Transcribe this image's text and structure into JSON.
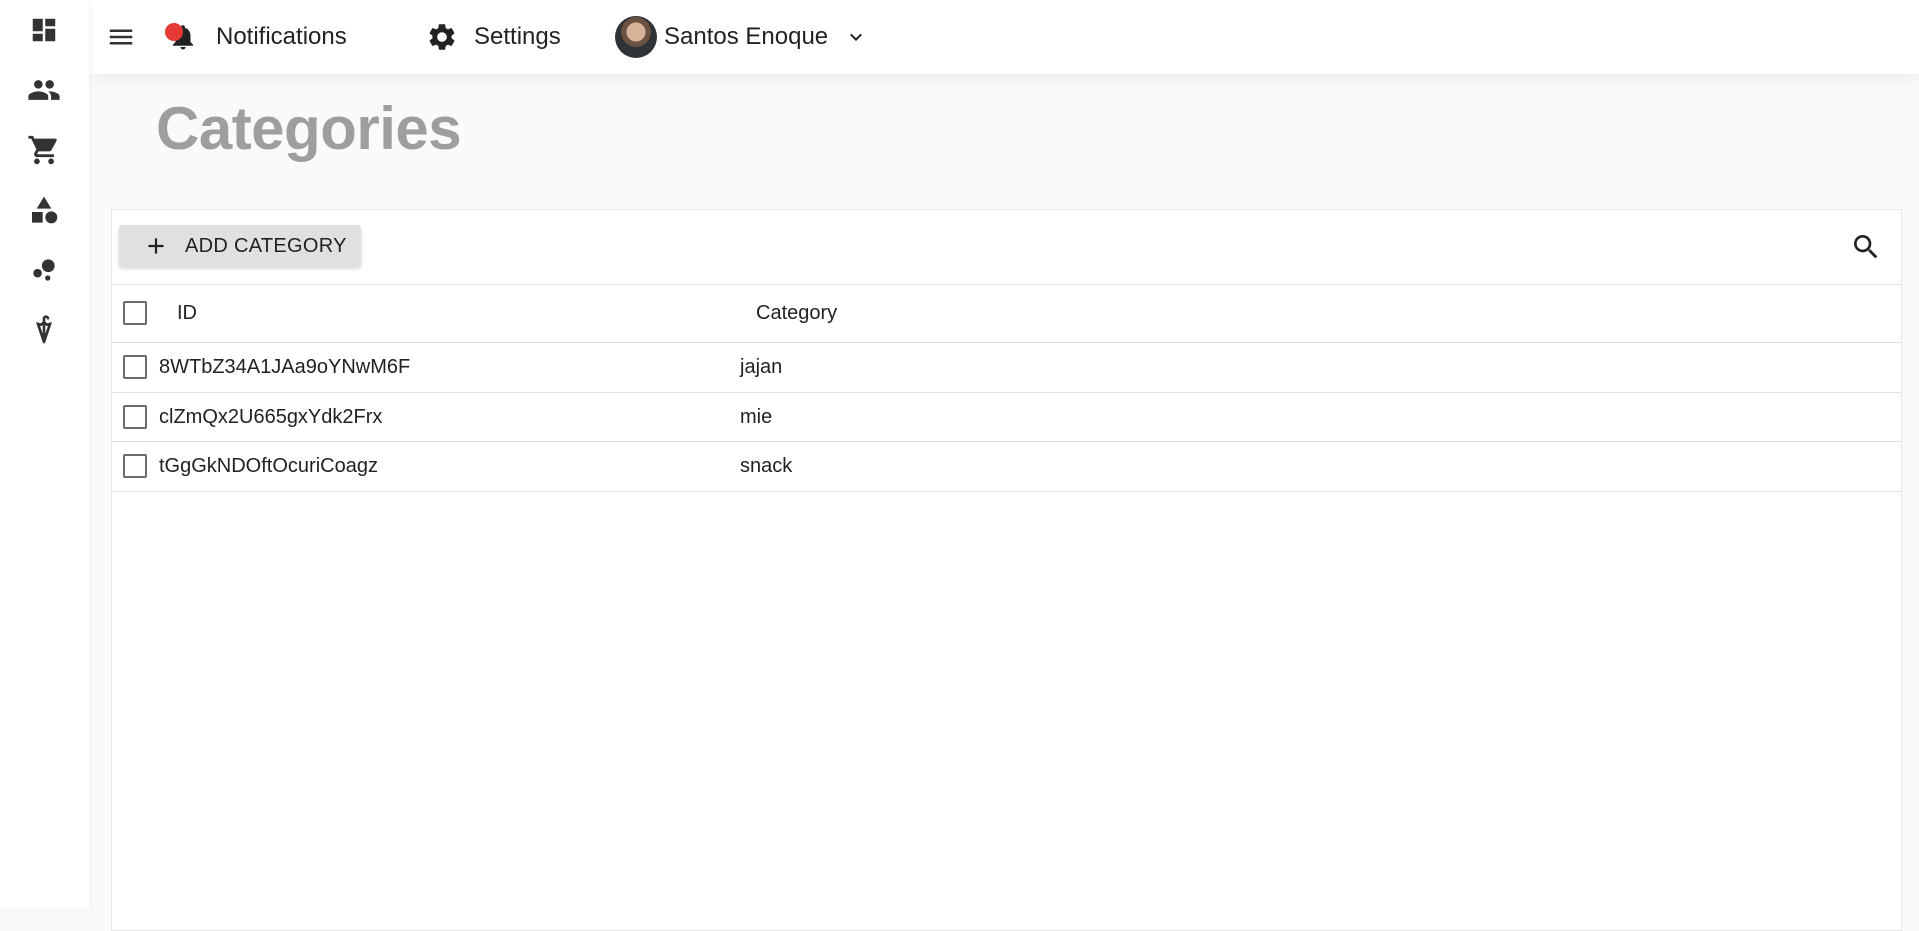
{
  "sidebar": {
    "items": [
      {
        "icon": "dashboard-icon"
      },
      {
        "icon": "people-icon"
      },
      {
        "icon": "shopping-cart-icon"
      },
      {
        "icon": "shapes-icon"
      },
      {
        "icon": "bubble-chart-icon"
      },
      {
        "icon": "umbrella-icon"
      }
    ]
  },
  "header": {
    "notifications_label": "Notifications",
    "settings_label": "Settings",
    "user_name": "Santos Enoque"
  },
  "page": {
    "title": "Categories"
  },
  "toolbar": {
    "add_label": "ADD CATEGORY"
  },
  "table": {
    "columns": [
      "ID",
      "Category"
    ],
    "rows": [
      {
        "id": "8WTbZ34A1JAa9oYNwM6F",
        "category": "jajan"
      },
      {
        "id": "clZmQx2U665gxYdk2Frx",
        "category": "mie"
      },
      {
        "id": "tGgGkNDOftOcuriCoagz",
        "category": "snack"
      }
    ]
  },
  "colors": {
    "notification_dot": "#e53935",
    "title": "#9e9e9e",
    "button_bg": "#e0e0e0"
  }
}
